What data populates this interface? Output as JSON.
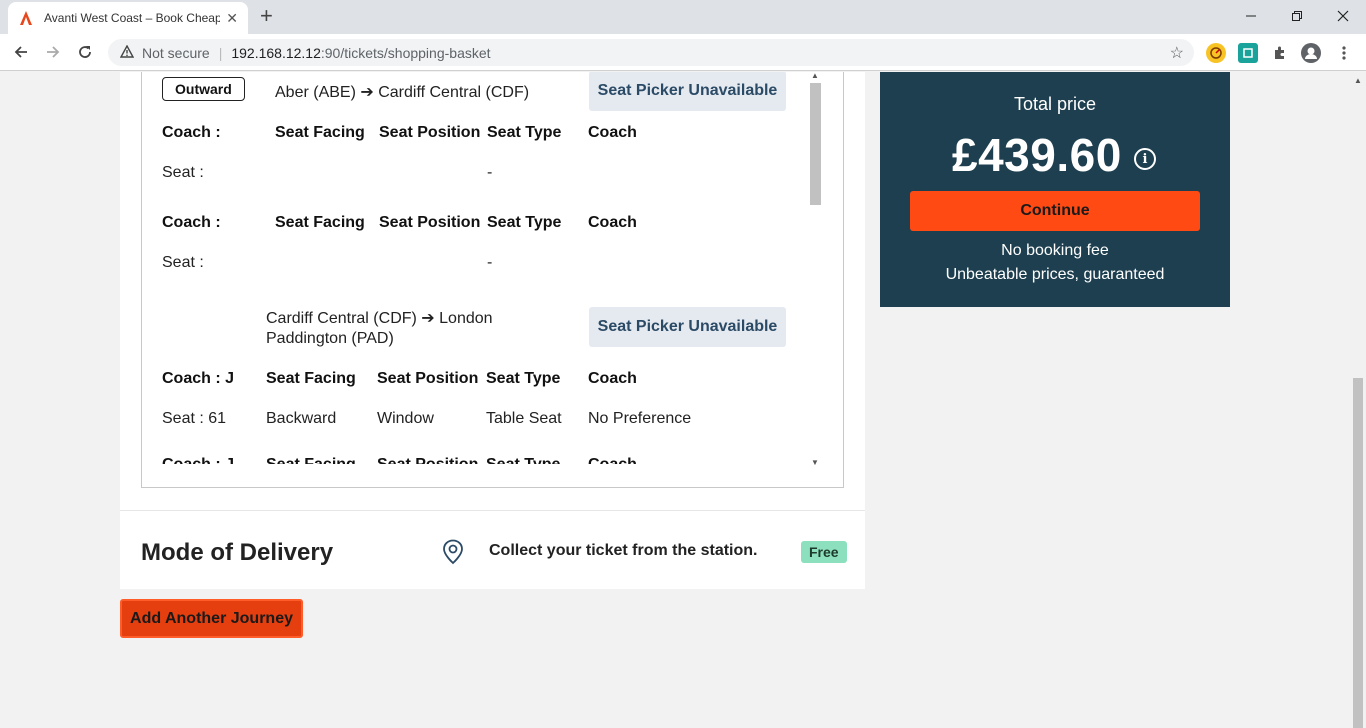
{
  "browser": {
    "tab_title": "Avanti West Coast – Book Cheap",
    "tab_close": "✕",
    "new_tab": "+",
    "security_label": "Not secure",
    "url_host": "192.168.12.12",
    "url_path": ":90/tickets/shopping-basket"
  },
  "outward_badge": "Outward",
  "legs": [
    {
      "route": "Aber (ABE) ➔ Cardiff Central (CDF)",
      "seat_picker": "Seat Picker Unavailable",
      "reservations": [
        {
          "headers": [
            "Coach :",
            "Seat Facing",
            "Seat Position",
            "Seat Type",
            "Coach"
          ],
          "values": [
            "Seat :",
            "",
            "",
            "-",
            ""
          ]
        },
        {
          "headers": [
            "Coach :",
            "Seat Facing",
            "Seat Position",
            "Seat Type",
            "Coach"
          ],
          "values": [
            "Seat :",
            "",
            "",
            "-",
            ""
          ]
        }
      ]
    },
    {
      "route_line1": "Cardiff Central (CDF) ➔ London",
      "route_line2": "Paddington (PAD)",
      "seat_picker": "Seat Picker Unavailable",
      "reservations": [
        {
          "headers": [
            "Coach : J",
            "Seat Facing",
            "Seat Position",
            "Seat Type",
            "Coach"
          ],
          "values": [
            "Seat : 61",
            "Backward",
            "Window",
            "Table Seat",
            "No Preference"
          ]
        },
        {
          "headers": [
            "Coach : J",
            "Seat Facing",
            "Seat Position",
            "Seat Type",
            "Coach"
          ],
          "values": []
        }
      ]
    }
  ],
  "delivery": {
    "heading": "Mode of Delivery",
    "method": "Collect your ticket from the station.",
    "price_badge": "Free"
  },
  "add_journey_label": "Add Another Journey",
  "summary": {
    "total_label": "Total price",
    "total_amount": "£439.60",
    "info_glyph": "i",
    "continue_label": "Continue",
    "note1": "No booking fee",
    "note2": "Unbeatable prices, guaranteed"
  },
  "colors": {
    "brand_dark": "#1d3f4f",
    "accent_orange": "#ff4a14",
    "free_badge": "#8ce0bd"
  }
}
